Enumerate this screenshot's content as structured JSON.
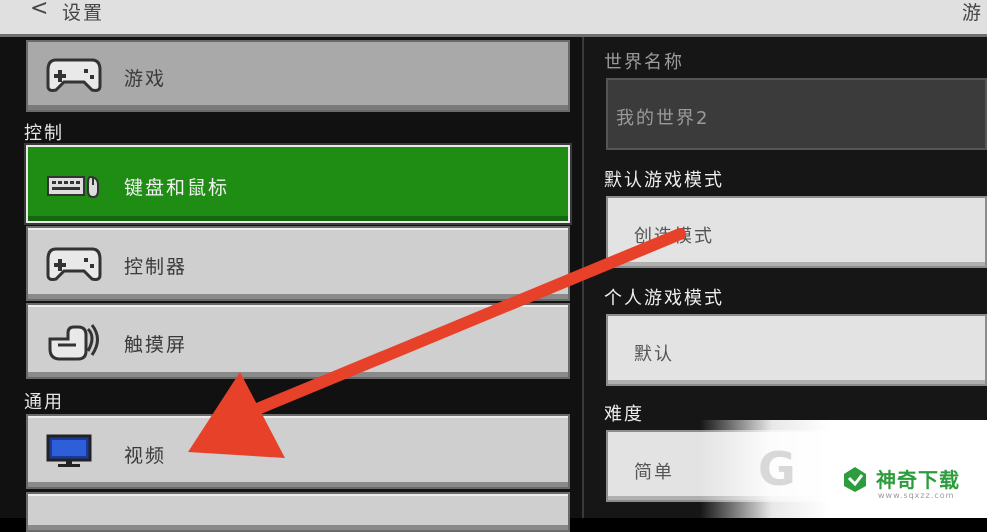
{
  "header": {
    "back_glyph": "<",
    "title": "设置",
    "right_title": "游"
  },
  "sidebar": {
    "items": [
      {
        "label": "游戏",
        "icon": "gamepad-icon",
        "state": "partial"
      },
      {
        "label": "键盘和鼠标",
        "icon": "keyboard-mouse-icon",
        "state": "selected"
      },
      {
        "label": "控制器",
        "icon": "gamepad-icon",
        "state": "normal"
      },
      {
        "label": "触摸屏",
        "icon": "touch-hand-icon",
        "state": "normal"
      },
      {
        "label": "视频",
        "icon": "monitor-icon",
        "state": "normal"
      }
    ],
    "sections": {
      "controls": "控制",
      "general": "通用"
    }
  },
  "settings": {
    "world_name": {
      "label": "世界名称",
      "value": "我的世界2",
      "disabled": true
    },
    "default_game_mode": {
      "label": "默认游戏模式",
      "value": "创造模式"
    },
    "personal_game_mode": {
      "label": "个人游戏模式",
      "value": "默认"
    },
    "difficulty": {
      "label": "难度",
      "value": "简单"
    }
  },
  "watermark": {
    "brand": "神奇下载",
    "url": "www.sqxzz.com"
  },
  "colors": {
    "accent_green": "#1f8c14",
    "annotation_arrow": "#e8412a"
  }
}
